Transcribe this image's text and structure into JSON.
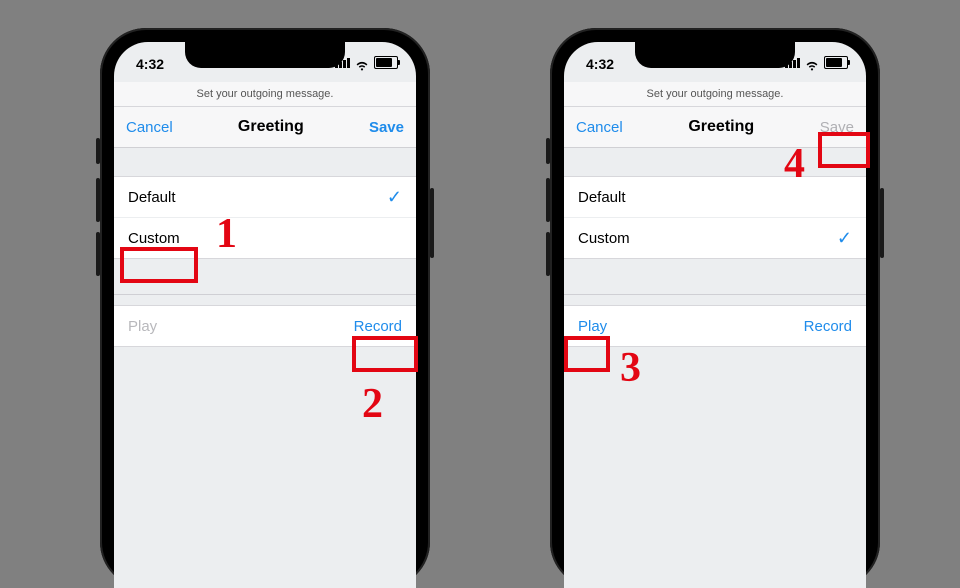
{
  "status": {
    "time": "4:32"
  },
  "screen1": {
    "subhead": "Set your outgoing message.",
    "nav": {
      "cancel": "Cancel",
      "title": "Greeting",
      "save": "Save",
      "save_enabled": true
    },
    "rows": {
      "default": "Default",
      "custom": "Custom",
      "checked": "default"
    },
    "controls": {
      "play": "Play",
      "play_enabled": false,
      "record": "Record"
    }
  },
  "screen2": {
    "subhead": "Set your outgoing message.",
    "nav": {
      "cancel": "Cancel",
      "title": "Greeting",
      "save": "Save",
      "save_enabled": false
    },
    "rows": {
      "default": "Default",
      "custom": "Custom",
      "checked": "custom"
    },
    "controls": {
      "play": "Play",
      "play_enabled": true,
      "record": "Record"
    }
  },
  "annotations": {
    "n1": "1",
    "n2": "2",
    "n3": "3",
    "n4": "4"
  }
}
